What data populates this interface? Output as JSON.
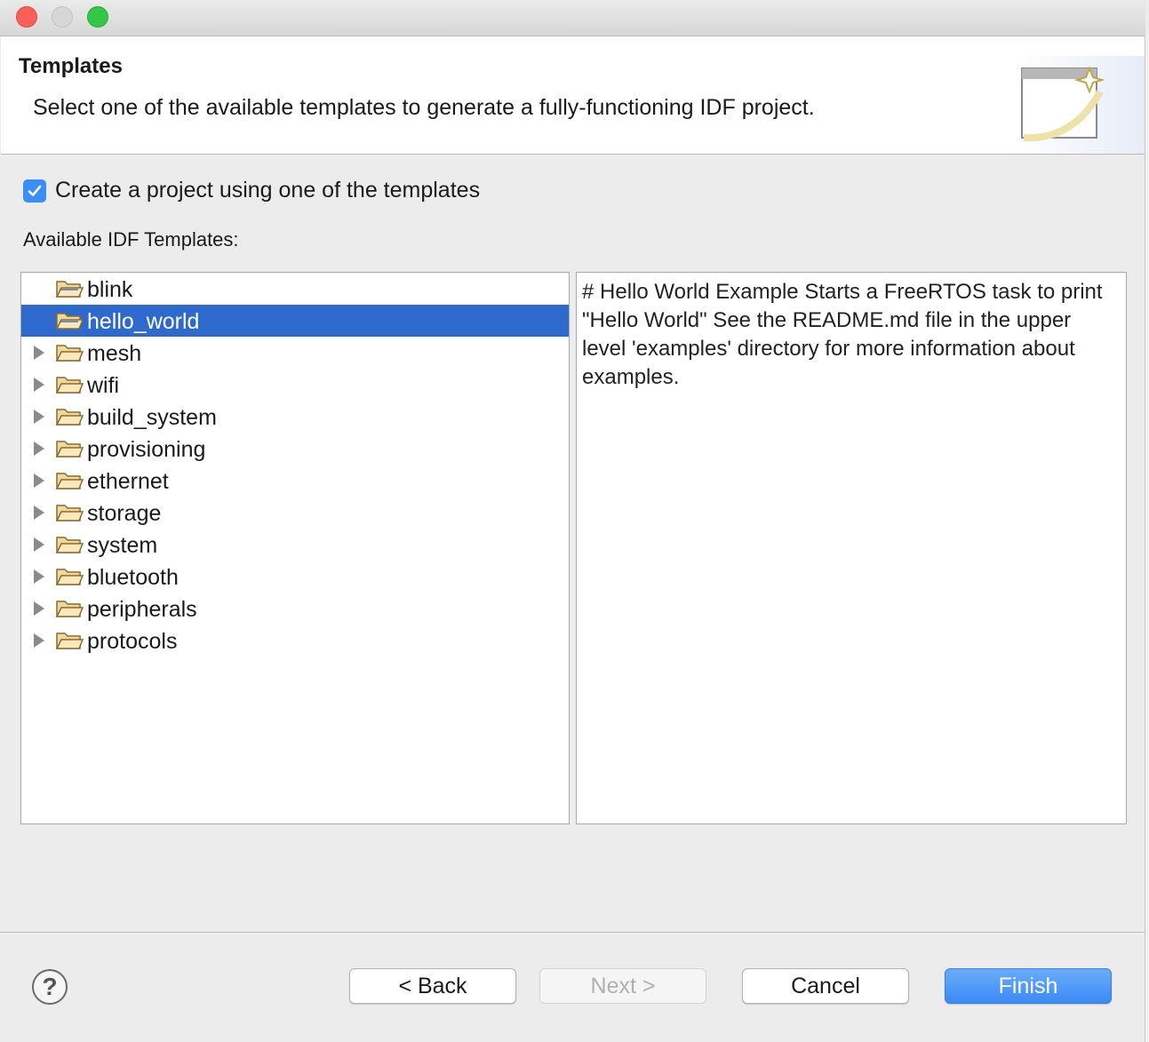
{
  "window": {
    "traffic_lights": {
      "close": "#fc5f57",
      "minimize": "#d7d7d7",
      "maximize": "#33c748"
    }
  },
  "header": {
    "title": "Templates",
    "description": "Select one of the available templates to generate a fully-functioning IDF project."
  },
  "options": {
    "use_template_checkbox": {
      "label": "Create a project using one of the templates",
      "checked": true
    }
  },
  "templates": {
    "label": "Available IDF Templates:",
    "items": [
      {
        "label": "blink",
        "expandable": false,
        "selected": false
      },
      {
        "label": "hello_world",
        "expandable": false,
        "selected": true
      },
      {
        "label": "mesh",
        "expandable": true,
        "selected": false
      },
      {
        "label": "wifi",
        "expandable": true,
        "selected": false
      },
      {
        "label": "build_system",
        "expandable": true,
        "selected": false
      },
      {
        "label": "provisioning",
        "expandable": true,
        "selected": false
      },
      {
        "label": "ethernet",
        "expandable": true,
        "selected": false
      },
      {
        "label": "storage",
        "expandable": true,
        "selected": false
      },
      {
        "label": "system",
        "expandable": true,
        "selected": false
      },
      {
        "label": "bluetooth",
        "expandable": true,
        "selected": false
      },
      {
        "label": "peripherals",
        "expandable": true,
        "selected": false
      },
      {
        "label": "protocols",
        "expandable": true,
        "selected": false
      }
    ],
    "description": "# Hello World Example Starts a FreeRTOS task to print \"Hello World\" See the README.md file in the upper level 'examples' directory for more information about examples."
  },
  "footer": {
    "help_icon": "question-mark",
    "back_label": "< Back",
    "next_label": "Next >",
    "cancel_label": "Cancel",
    "finish_label": "Finish"
  },
  "colors": {
    "selection": "#2e69cd",
    "accent": "#3b8df8"
  }
}
